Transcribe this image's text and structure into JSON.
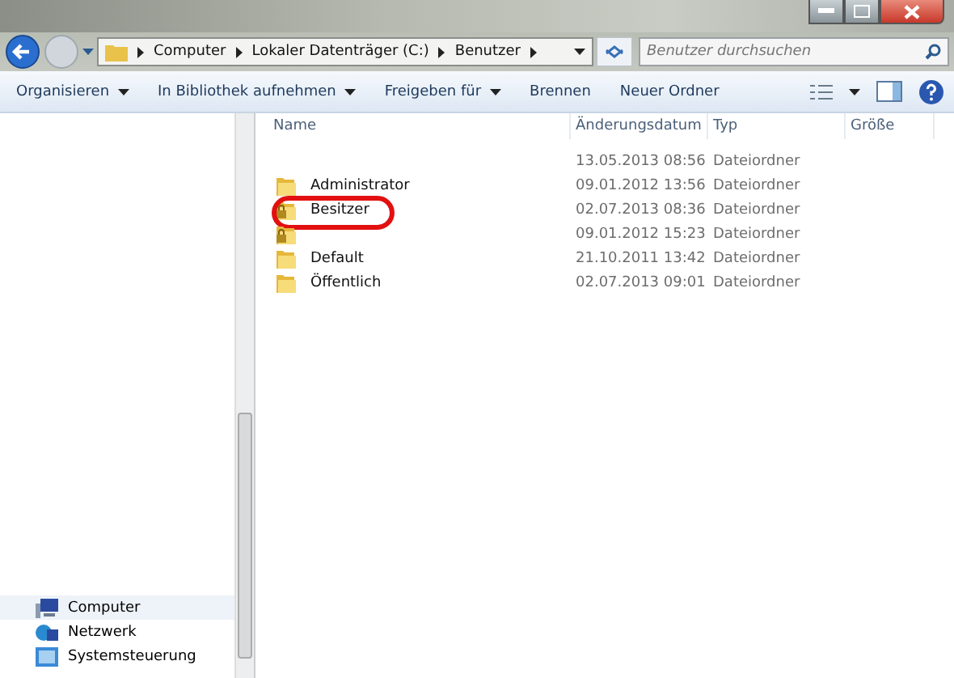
{
  "address_bar": {
    "crumbs": [
      "Computer",
      "Lokaler Datenträger (C:)",
      "Benutzer"
    ]
  },
  "search": {
    "placeholder": "Benutzer durchsuchen"
  },
  "toolbar": [
    {
      "label": "Organisieren",
      "dropdown": true
    },
    {
      "label": "In Bibliothek aufnehmen",
      "dropdown": true
    },
    {
      "label": "Freigeben für",
      "dropdown": true
    },
    {
      "label": "Brennen",
      "dropdown": false
    },
    {
      "label": "Neuer Ordner",
      "dropdown": false
    }
  ],
  "table": {
    "columns": [
      "Name",
      "Änderungsdatum",
      "Typ",
      "Größe"
    ],
    "rows": [
      {
        "kind": "none",
        "name": "",
        "date": "13.05.2013 08:56",
        "type": "Dateiordner",
        "circled": false
      },
      {
        "kind": "folder",
        "name": "Administrator",
        "date": "09.01.2012 13:56",
        "type": "Dateiordner",
        "circled": false
      },
      {
        "kind": "locked",
        "name": "Besitzer",
        "date": "02.07.2013 08:36",
        "type": "Dateiordner",
        "circled": true
      },
      {
        "kind": "locked",
        "name": "",
        "date": "09.01.2012 15:23",
        "type": "Dateiordner",
        "circled": false
      },
      {
        "kind": "folder",
        "name": "Default",
        "date": "21.10.2011 13:42",
        "type": "Dateiordner",
        "circled": false
      },
      {
        "kind": "folder",
        "name": "Öffentlich",
        "date": "02.07.2013 09:01",
        "type": "Dateiordner",
        "circled": false
      }
    ]
  },
  "sidebar": {
    "items": [
      {
        "label": "Computer",
        "kind": "computer",
        "selected": true
      },
      {
        "label": "Netzwerk",
        "kind": "network",
        "selected": false
      },
      {
        "label": "Systemsteuerung",
        "kind": "panel",
        "selected": false
      }
    ]
  }
}
